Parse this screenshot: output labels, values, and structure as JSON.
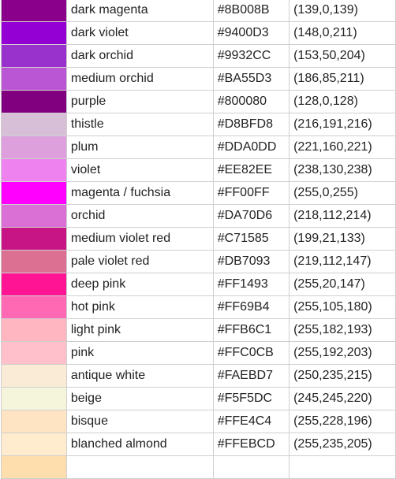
{
  "table": {
    "rows": [
      {
        "name": "dark magenta",
        "hex": "#8B008B",
        "rgb": "(139,0,139)",
        "swatch": "#8B008B"
      },
      {
        "name": "dark violet",
        "hex": "#9400D3",
        "rgb": "(148,0,211)",
        "swatch": "#9400D3"
      },
      {
        "name": "dark orchid",
        "hex": "#9932CC",
        "rgb": "(153,50,204)",
        "swatch": "#9932CC"
      },
      {
        "name": "medium orchid",
        "hex": "#BA55D3",
        "rgb": "(186,85,211)",
        "swatch": "#BA55D3"
      },
      {
        "name": "purple",
        "hex": "#800080",
        "rgb": "(128,0,128)",
        "swatch": "#800080"
      },
      {
        "name": "thistle",
        "hex": "#D8BFD8",
        "rgb": "(216,191,216)",
        "swatch": "#D8BFD8"
      },
      {
        "name": "plum",
        "hex": "#DDA0DD",
        "rgb": "(221,160,221)",
        "swatch": "#DDA0DD"
      },
      {
        "name": "violet",
        "hex": "#EE82EE",
        "rgb": "(238,130,238)",
        "swatch": "#EE82EE"
      },
      {
        "name": "magenta / fuchsia",
        "hex": "#FF00FF",
        "rgb": "(255,0,255)",
        "swatch": "#FF00FF"
      },
      {
        "name": "orchid",
        "hex": "#DA70D6",
        "rgb": "(218,112,214)",
        "swatch": "#DA70D6"
      },
      {
        "name": "medium violet red",
        "hex": "#C71585",
        "rgb": "(199,21,133)",
        "swatch": "#C71585"
      },
      {
        "name": "pale violet red",
        "hex": "#DB7093",
        "rgb": "(219,112,147)",
        "swatch": "#DB7093"
      },
      {
        "name": "deep pink",
        "hex": "#FF1493",
        "rgb": "(255,20,147)",
        "swatch": "#FF1493"
      },
      {
        "name": "hot pink",
        "hex": "#FF69B4",
        "rgb": "(255,105,180)",
        "swatch": "#FF69B4"
      },
      {
        "name": "light pink",
        "hex": "#FFB6C1",
        "rgb": "(255,182,193)",
        "swatch": "#FFB6C1"
      },
      {
        "name": "pink",
        "hex": "#FFC0CB",
        "rgb": "(255,192,203)",
        "swatch": "#FFC0CB"
      },
      {
        "name": "antique white",
        "hex": "#FAEBD7",
        "rgb": "(250,235,215)",
        "swatch": "#FAEBD7"
      },
      {
        "name": "beige",
        "hex": "#F5F5DC",
        "rgb": "(245,245,220)",
        "swatch": "#F5F5DC"
      },
      {
        "name": "bisque",
        "hex": "#FFE4C4",
        "rgb": "(255,228,196)",
        "swatch": "#FFE4C4"
      },
      {
        "name": "blanched almond",
        "hex": "#FFEBCD",
        "rgb": "(255,235,205)",
        "swatch": "#FFEBCD"
      },
      {
        "name": "",
        "hex": "",
        "rgb": "",
        "swatch": "#FFDEAD"
      }
    ]
  }
}
